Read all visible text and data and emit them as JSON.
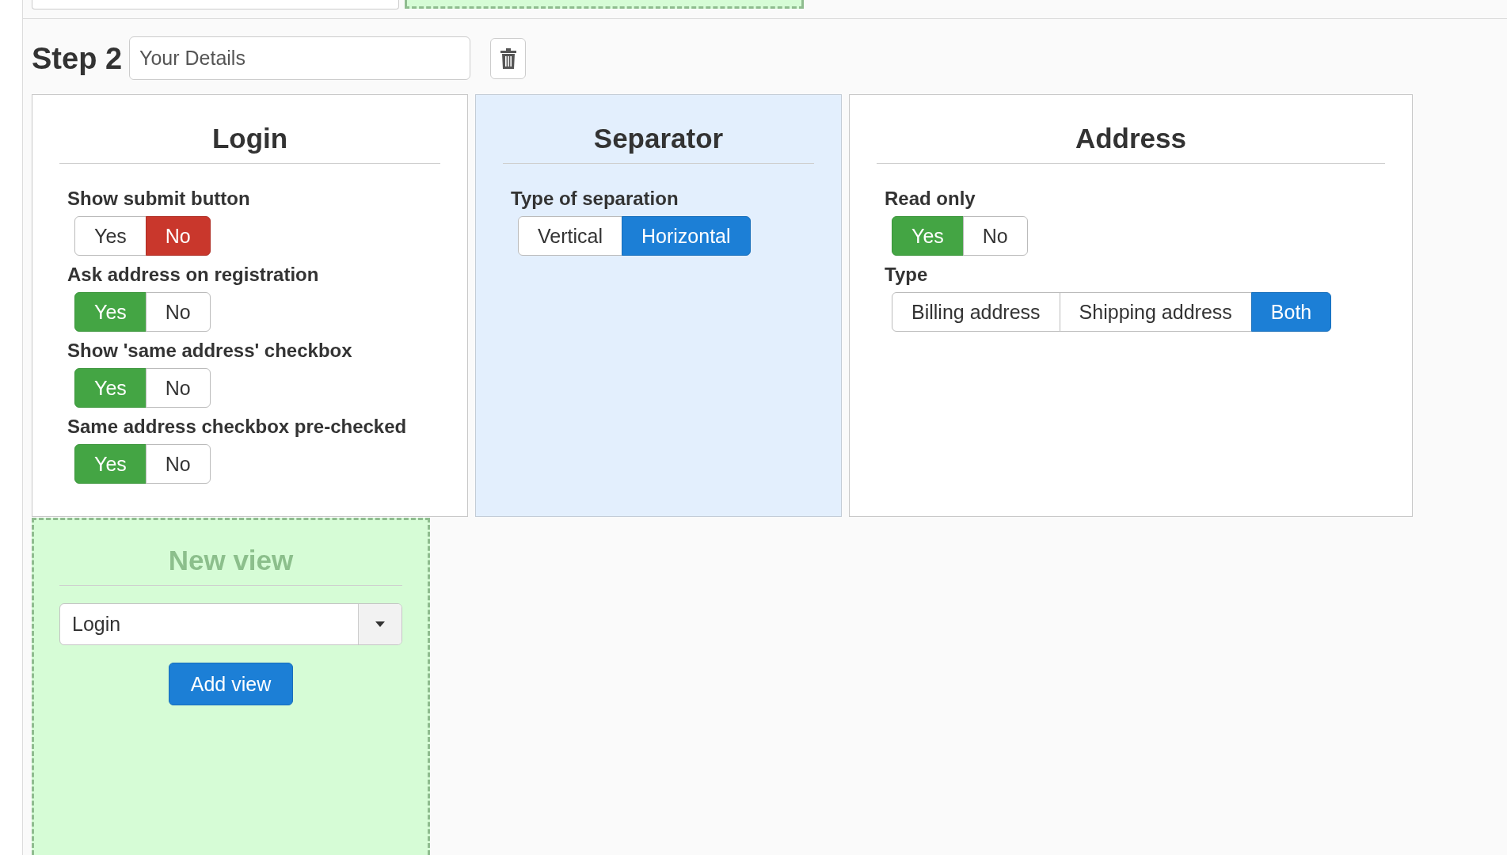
{
  "step": {
    "label": "Step 2",
    "name_value": "Your Details"
  },
  "views": [
    {
      "title": "Login",
      "selected": false,
      "settings": [
        {
          "label": "Show submit button",
          "kind": "yes_no",
          "options": [
            {
              "label": "Yes",
              "selected": false
            },
            {
              "label": "No",
              "selected": true
            }
          ]
        },
        {
          "label": "Ask address on registration",
          "kind": "yes_no",
          "options": [
            {
              "label": "Yes",
              "selected": true
            },
            {
              "label": "No",
              "selected": false
            }
          ]
        },
        {
          "label": "Show 'same address' checkbox",
          "kind": "yes_no",
          "options": [
            {
              "label": "Yes",
              "selected": true
            },
            {
              "label": "No",
              "selected": false
            }
          ]
        },
        {
          "label": "Same address checkbox pre-checked",
          "kind": "yes_no",
          "options": [
            {
              "label": "Yes",
              "selected": true
            },
            {
              "label": "No",
              "selected": false
            }
          ]
        }
      ]
    },
    {
      "title": "Separator",
      "selected": true,
      "settings": [
        {
          "label": "Type of separation",
          "kind": "choice",
          "options": [
            {
              "label": "Vertical",
              "selected": false
            },
            {
              "label": "Horizontal",
              "selected": true
            }
          ]
        }
      ]
    },
    {
      "title": "Address",
      "selected": false,
      "settings": [
        {
          "label": "Read only",
          "kind": "yes_no",
          "options": [
            {
              "label": "Yes",
              "selected": true
            },
            {
              "label": "No",
              "selected": false
            }
          ]
        },
        {
          "label": "Type",
          "kind": "choice",
          "options": [
            {
              "label": "Billing address",
              "selected": false
            },
            {
              "label": "Shipping address",
              "selected": false
            },
            {
              "label": "Both",
              "selected": true
            }
          ]
        }
      ]
    }
  ],
  "new_view": {
    "title": "New view",
    "select_value": "Login",
    "add_button": "Add view"
  }
}
